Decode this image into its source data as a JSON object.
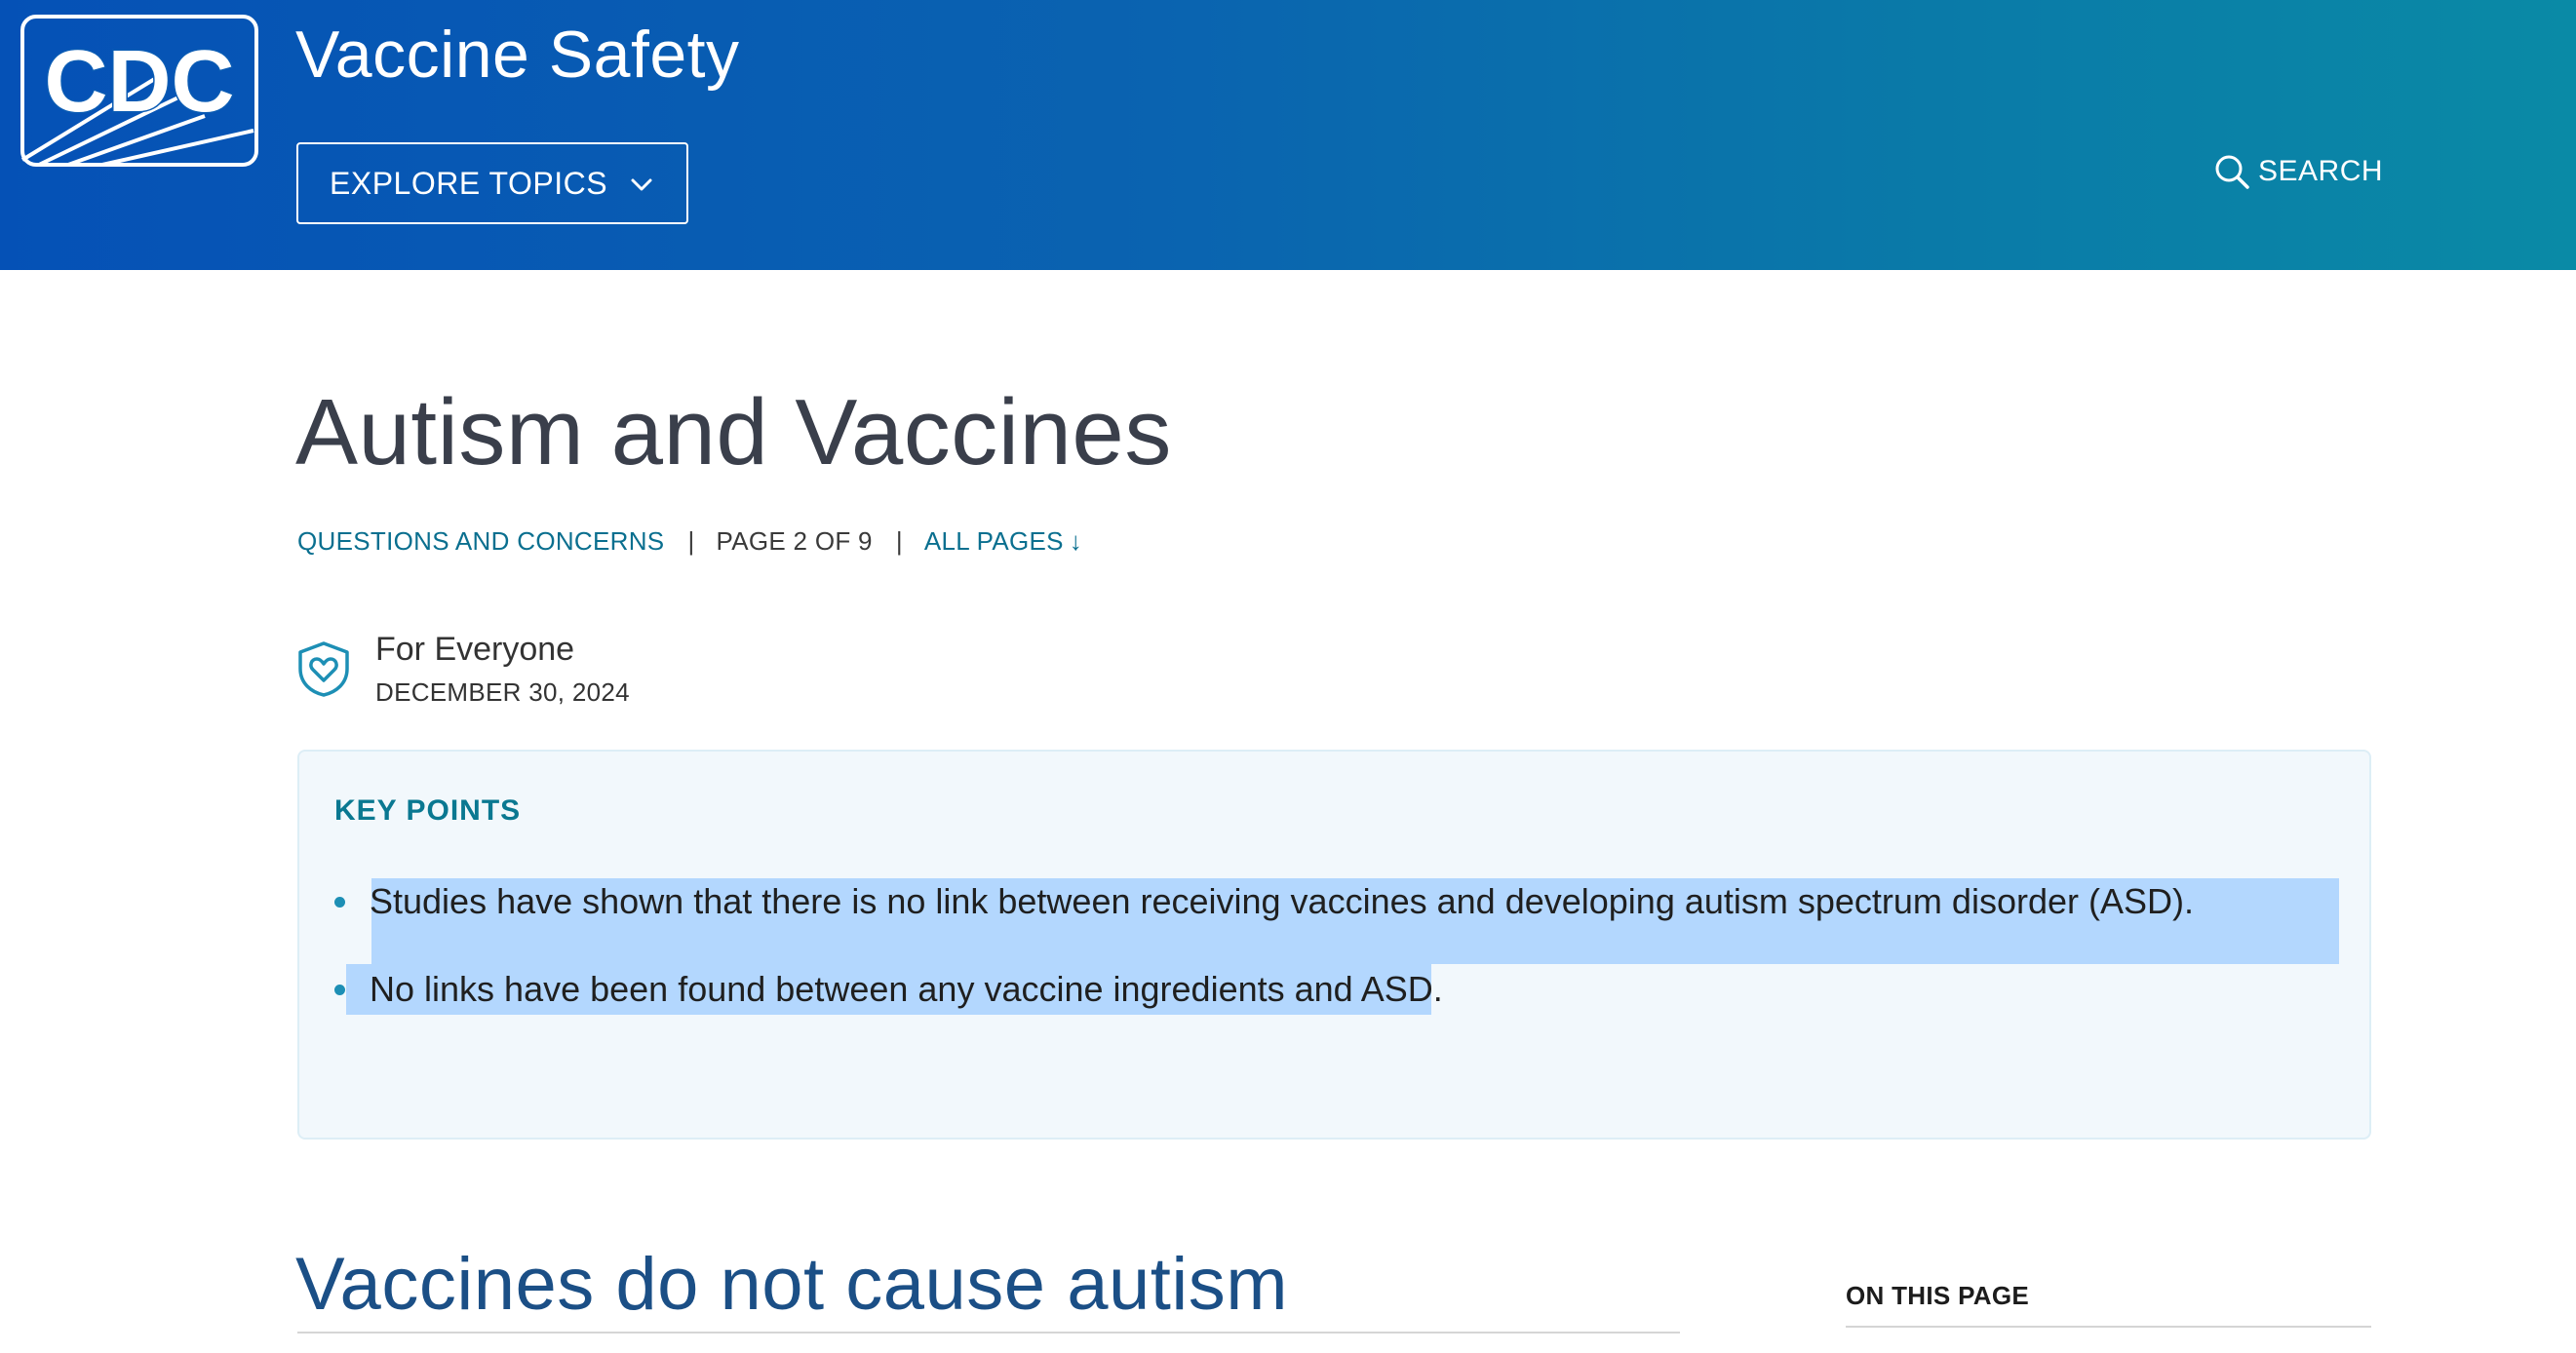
{
  "header": {
    "logo_text": "CDC",
    "site_title": "Vaccine Safety",
    "explore_label": "EXPLORE TOPICS",
    "search_label": "SEARCH",
    "colors": {
      "gradient_start": "#0551b6",
      "gradient_end": "#0a8aa6"
    }
  },
  "page": {
    "title": "Autism and Vaccines",
    "breadcrumb": {
      "parent": "QUESTIONS AND CONCERNS",
      "separator": "|",
      "page_count": "PAGE 2 OF 9",
      "all_pages": "ALL PAGES",
      "all_pages_arrow": "↓"
    },
    "audience": {
      "label": "For Everyone",
      "date": "DECEMBER 30, 2024",
      "icon": "shield-heart-icon"
    }
  },
  "key_points": {
    "title": "KEY POINTS",
    "items": [
      "Studies have shown that there is no link between receiving vaccines and developing autism spectrum disorder (ASD).",
      "No links have been found between any vaccine ingredients and ASD."
    ],
    "selection_color": "#b3d7fe"
  },
  "section": {
    "heading": "Vaccines do not cause autism",
    "on_this_page": "ON THIS PAGE"
  }
}
